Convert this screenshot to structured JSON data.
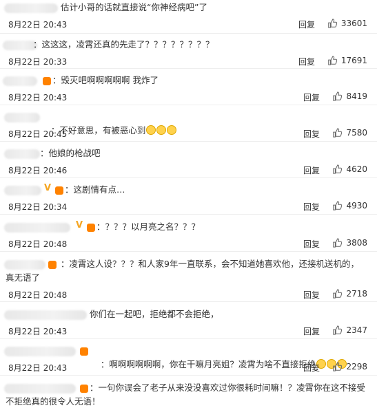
{
  "ui": {
    "reply_label": "回复"
  },
  "comments": [
    {
      "text": "估计小哥的话就直接说“你神经病吧”了",
      "date": "8月22日 20:43",
      "likes": "33601"
    },
    {
      "text": "：这这这，凌霄还真的先走了？？？？？？？？",
      "date": "8月22日 20:33",
      "likes": "17691"
    },
    {
      "text": "：毁灭吧啊啊啊啊啊 我炸了",
      "date": "8月22日 20:43",
      "likes": "8419"
    },
    {
      "text": "：不好意思，有被恶心到",
      "date": "8月22日 20:45",
      "likes": "7580"
    },
    {
      "text": "：他娘的枪战吧",
      "date": "8月22日 20:46",
      "likes": "4620"
    },
    {
      "text": "：这剧情有点…",
      "date": "8月22日 20:34",
      "likes": "4930"
    },
    {
      "text": "：？？？以月亮之名？？？",
      "date": "8月22日 20:48",
      "likes": "3808"
    },
    {
      "text": "：凌霄这人设？？？和人家9年一直联系，会不知道她喜欢他，还接机送机的，真无语了",
      "date": "8月22日 20:48",
      "likes": "2718"
    },
    {
      "text": "你们在一起吧，拒绝都不会拒绝，",
      "date": "8月22日 20:43",
      "likes": "2347"
    },
    {
      "text": "：啊啊啊啊啊啊，你在干嘛月亮姐？凌霄为啥不直接拒绝",
      "date": "8月22日 20:43",
      "likes": "2298"
    },
    {
      "text": "：一句你误会了老子从来没没喜欢过你很耗时间嘛！？凌霄你在这不接受不拒绝真的很令人无语！",
      "date": "",
      "likes": ""
    }
  ]
}
